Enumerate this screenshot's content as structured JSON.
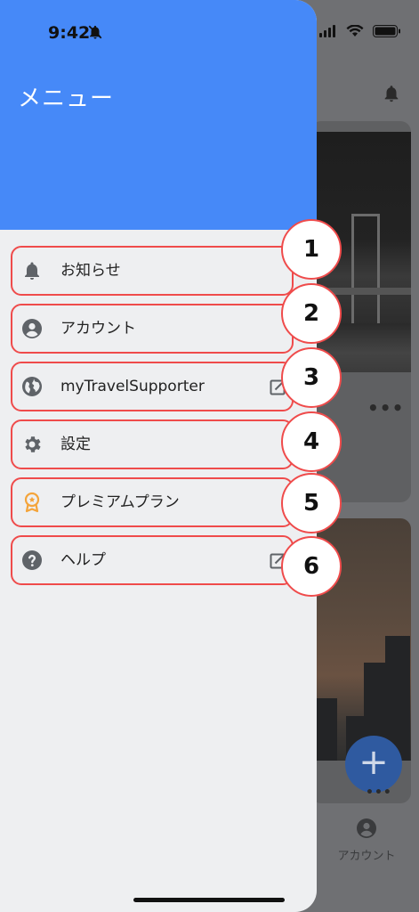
{
  "status_bar": {
    "time": "9:42"
  },
  "drawer": {
    "title": "メニュー",
    "items": [
      {
        "label": "お知らせ",
        "icon": "bell-icon",
        "external": false,
        "badge": "1"
      },
      {
        "label": "アカウント",
        "icon": "account-circle-icon",
        "external": false,
        "badge": "2"
      },
      {
        "label": "myTravelSupporter",
        "icon": "globe-icon",
        "external": true,
        "badge": "3"
      },
      {
        "label": "設定",
        "icon": "gear-icon",
        "external": false,
        "badge": "4"
      },
      {
        "label": "プレミアムプラン",
        "icon": "premium-award-icon",
        "external": false,
        "badge": "5"
      },
      {
        "label": "ヘルプ",
        "icon": "help-icon",
        "external": true,
        "badge": "6"
      }
    ]
  },
  "background_app": {
    "bottom_nav_account_label": "アカウント",
    "more_label": "•••",
    "fab_label": "+"
  },
  "colors": {
    "header": "#4689f8",
    "drawer_bg": "#eeeff1",
    "annotation_border": "#ef4b4b",
    "premium_icon": "#f4a43b",
    "icon_gray": "#5f6368"
  }
}
